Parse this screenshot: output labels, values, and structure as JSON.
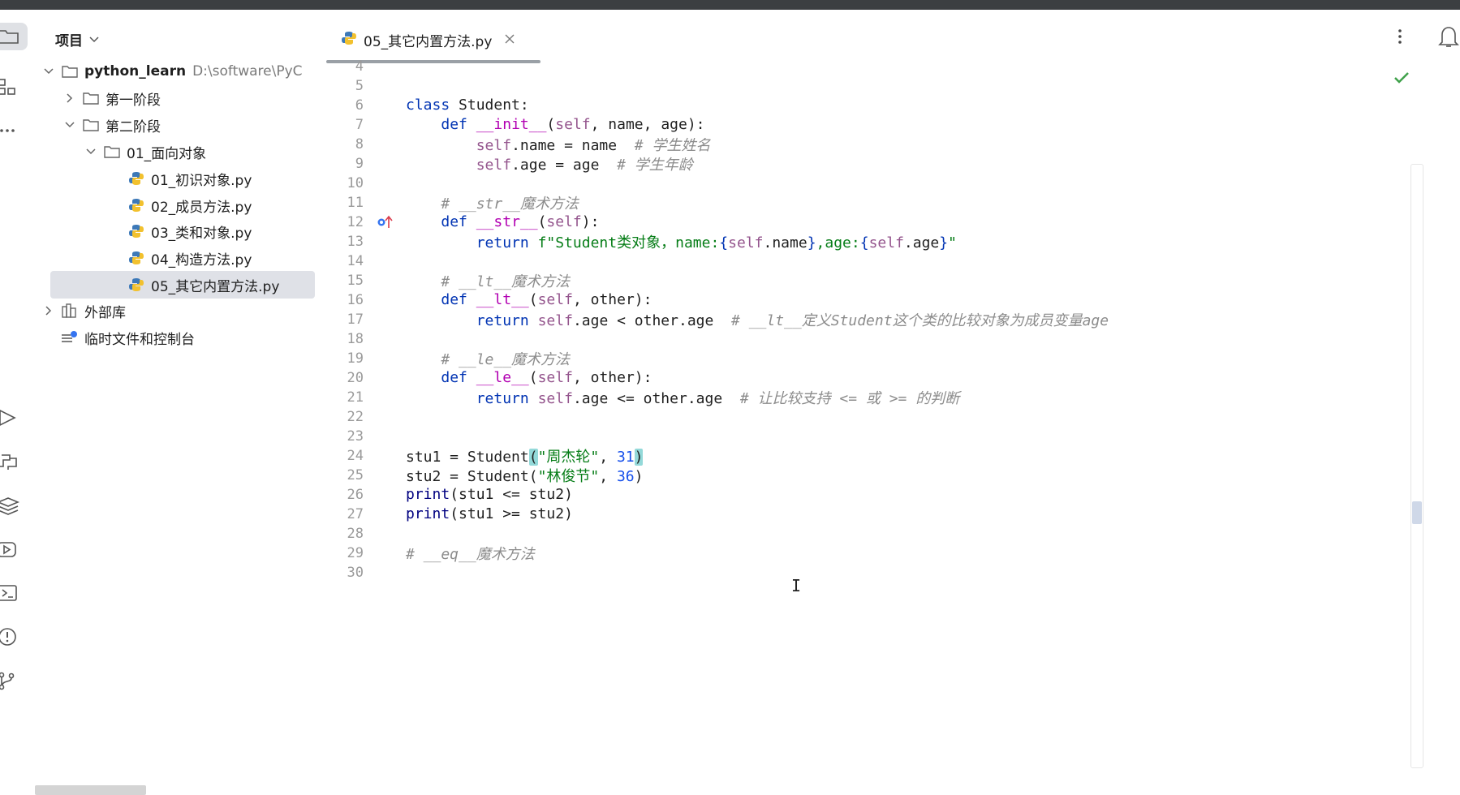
{
  "project_panel": {
    "title": "项目",
    "tree": [
      {
        "label": "python_learn",
        "path": "D:\\software\\PyC",
        "type": "folder",
        "expanded": true
      },
      {
        "label": "第一阶段",
        "type": "folder",
        "expanded": false
      },
      {
        "label": "第二阶段",
        "type": "folder",
        "expanded": true
      },
      {
        "label": "01_面向对象",
        "type": "folder",
        "expanded": true
      },
      {
        "label": "01_初识对象.py",
        "type": "python-file"
      },
      {
        "label": "02_成员方法.py",
        "type": "python-file"
      },
      {
        "label": "03_类和对象.py",
        "type": "python-file"
      },
      {
        "label": "04_构造方法.py",
        "type": "python-file"
      },
      {
        "label": "05_其它内置方法.py",
        "type": "python-file",
        "selected": true
      },
      {
        "label": "外部库",
        "type": "library",
        "expanded": false
      },
      {
        "label": "临时文件和控制台",
        "type": "scratches"
      }
    ]
  },
  "editor": {
    "active_tab": "05_其它内置方法.py",
    "status": "no-problems-check",
    "lines": [
      {
        "n": "4",
        "tokens": []
      },
      {
        "n": "5",
        "tokens": []
      },
      {
        "n": "6",
        "tokens": [
          [
            "kw",
            "class"
          ],
          [
            "src",
            " Student:"
          ]
        ]
      },
      {
        "n": "7",
        "tokens": [
          [
            "src",
            "    "
          ],
          [
            "kw",
            "def"
          ],
          [
            "src",
            " "
          ],
          [
            "mg",
            "__init__"
          ],
          [
            "src",
            "("
          ],
          [
            "sf",
            "self"
          ],
          [
            "src",
            ", name, age):"
          ]
        ]
      },
      {
        "n": "8",
        "tokens": [
          [
            "src",
            "        "
          ],
          [
            "sf",
            "self"
          ],
          [
            "src",
            ".name = name  "
          ],
          [
            "cm",
            "# 学生姓名"
          ]
        ]
      },
      {
        "n": "9",
        "tokens": [
          [
            "src",
            "        "
          ],
          [
            "sf",
            "self"
          ],
          [
            "src",
            ".age = age  "
          ],
          [
            "cm",
            "# 学生年龄"
          ]
        ]
      },
      {
        "n": "10",
        "tokens": []
      },
      {
        "n": "11",
        "tokens": [
          [
            "src",
            "    "
          ],
          [
            "cm",
            "# __str__魔术方法"
          ]
        ]
      },
      {
        "n": "12",
        "gutter": "override-icon",
        "tokens": [
          [
            "src",
            "    "
          ],
          [
            "kw",
            "def"
          ],
          [
            "src",
            " "
          ],
          [
            "mg",
            "__str__"
          ],
          [
            "src",
            "("
          ],
          [
            "sf",
            "self"
          ],
          [
            "src",
            "):"
          ]
        ]
      },
      {
        "n": "13",
        "tokens": [
          [
            "src",
            "        "
          ],
          [
            "kw",
            "return"
          ],
          [
            "src",
            " "
          ],
          [
            "str",
            "f\"Student类对象，name:"
          ],
          [
            "kw",
            "{"
          ],
          [
            "sf",
            "self"
          ],
          [
            "src",
            ".name"
          ],
          [
            "kw",
            "}"
          ],
          [
            "str",
            ",age:"
          ],
          [
            "kw",
            "{"
          ],
          [
            "sf",
            "self"
          ],
          [
            "src",
            ".age"
          ],
          [
            "kw",
            "}"
          ],
          [
            "str",
            "\""
          ]
        ]
      },
      {
        "n": "14",
        "tokens": []
      },
      {
        "n": "15",
        "tokens": [
          [
            "src",
            "    "
          ],
          [
            "cm",
            "# __lt__魔术方法"
          ]
        ]
      },
      {
        "n": "16",
        "tokens": [
          [
            "src",
            "    "
          ],
          [
            "kw",
            "def"
          ],
          [
            "src",
            " "
          ],
          [
            "mg",
            "__lt__"
          ],
          [
            "src",
            "("
          ],
          [
            "sf",
            "self"
          ],
          [
            "src",
            ", other):"
          ]
        ]
      },
      {
        "n": "17",
        "tokens": [
          [
            "src",
            "        "
          ],
          [
            "kw",
            "return"
          ],
          [
            "src",
            " "
          ],
          [
            "sf",
            "self"
          ],
          [
            "src",
            ".age < other.age  "
          ],
          [
            "cm",
            "# __lt__定义Student这个类的比较对象为成员变量age"
          ]
        ]
      },
      {
        "n": "18",
        "tokens": []
      },
      {
        "n": "19",
        "tokens": [
          [
            "src",
            "    "
          ],
          [
            "cm",
            "# __le__魔术方法"
          ]
        ]
      },
      {
        "n": "20",
        "tokens": [
          [
            "src",
            "    "
          ],
          [
            "kw",
            "def"
          ],
          [
            "src",
            " "
          ],
          [
            "mg",
            "__le__"
          ],
          [
            "src",
            "("
          ],
          [
            "sf",
            "self"
          ],
          [
            "src",
            ", other):"
          ]
        ]
      },
      {
        "n": "21",
        "tokens": [
          [
            "src",
            "        "
          ],
          [
            "kw",
            "return"
          ],
          [
            "src",
            " "
          ],
          [
            "sf",
            "self"
          ],
          [
            "src",
            ".age <= other.age  "
          ],
          [
            "cm",
            "# 让比较支持 <= 或 >= 的判断"
          ]
        ]
      },
      {
        "n": "22",
        "tokens": []
      },
      {
        "n": "23",
        "gutter": "bulb-icon",
        "tokens": []
      },
      {
        "n": "24",
        "tokens": [
          [
            "src",
            "stu1 = Student"
          ],
          [
            "hl",
            "("
          ],
          [
            "str",
            "\"周杰轮\""
          ],
          [
            "src",
            ", "
          ],
          [
            "num",
            "31"
          ],
          [
            "hl",
            ")"
          ]
        ]
      },
      {
        "n": "25",
        "tokens": [
          [
            "src",
            "stu2 = Student("
          ],
          [
            "str",
            "\"林俊节\""
          ],
          [
            "src",
            ", "
          ],
          [
            "num",
            "36"
          ],
          [
            "src",
            ")"
          ]
        ]
      },
      {
        "n": "26",
        "tokens": [
          [
            "bi",
            "print"
          ],
          [
            "src",
            "(stu1 <= stu2)"
          ]
        ]
      },
      {
        "n": "27",
        "tokens": [
          [
            "bi",
            "print"
          ],
          [
            "src",
            "(stu1 >= stu2)"
          ]
        ]
      },
      {
        "n": "28",
        "tokens": []
      },
      {
        "n": "29",
        "tokens": [
          [
            "cm",
            "# __eq__魔术方法"
          ]
        ]
      },
      {
        "n": "30",
        "tokens": []
      }
    ]
  },
  "colors": {
    "keyword": "#0033b3",
    "self": "#94558d",
    "magic": "#b200b2",
    "string": "#067d17",
    "number": "#1750eb",
    "comment": "#8c8c8c",
    "selection": "#dfe1e7",
    "check": "#3fa14a"
  }
}
